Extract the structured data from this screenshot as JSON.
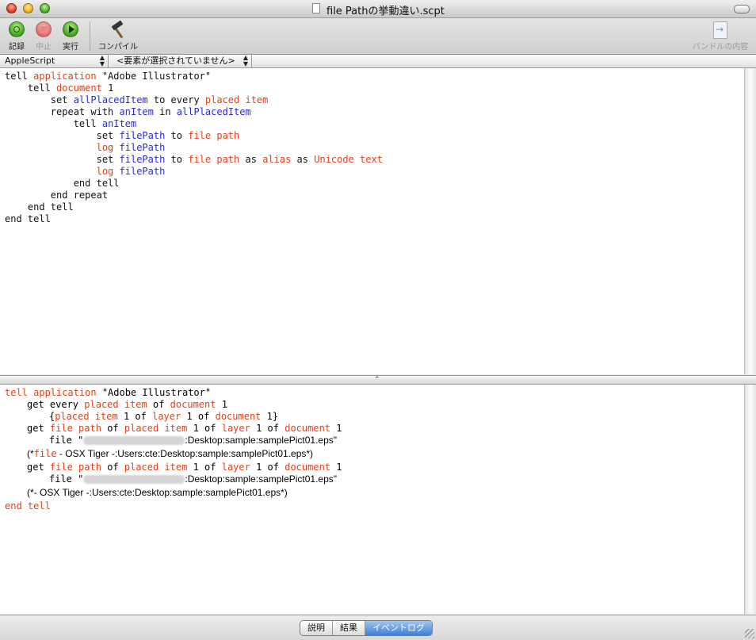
{
  "window": {
    "title": "file Pathの挙動違い.scpt"
  },
  "toolbar": {
    "record_label": "記録",
    "stop_label": "中止",
    "run_label": "実行",
    "compile_label": "コンパイル",
    "bundle_label": "バンドルの内容"
  },
  "navbar": {
    "language": "AppleScript",
    "element": "<要素が選択されていません>"
  },
  "script": {
    "l1_tell": "tell",
    "l1_app": "application",
    "l1_name": "\"Adobe Illustrator\"",
    "l2_tell": "tell",
    "l2_doc": "document",
    "l2_num": "1",
    "l3_set": "set",
    "l3_var": "allPlacedItem",
    "l3_to": "to every",
    "l3_cls": "placed item",
    "l4_repeat": "repeat with",
    "l4_var": "anItem",
    "l4_in": "in",
    "l4_var2": "allPlacedItem",
    "l5_tell": "tell",
    "l5_var": "anItem",
    "l6_set": "set",
    "l6_var": "filePath",
    "l6_to": "to",
    "l6_prop": "file path",
    "l7_log": "log",
    "l7_var": "filePath",
    "l8_set": "set",
    "l8_var": "filePath",
    "l8_to": "to",
    "l8_prop": "file path",
    "l8_as": "as",
    "l8_alias": "alias",
    "l8_as2": "as",
    "l8_uni": "Unicode text",
    "l9_log": "log",
    "l9_var": "filePath",
    "l10": "end tell",
    "l11": "end repeat",
    "l12": "end tell",
    "l13": "end tell"
  },
  "event_log": {
    "e1_tell": "tell application",
    "e1_name": "\"Adobe Illustrator\"",
    "e2_get": "get every",
    "e2_cls": "placed item",
    "e2_of": "of",
    "e2_doc": "document",
    "e2_num": "1",
    "e3_open": "{",
    "e3_cls": "placed item",
    "e3_rest1": "1 of",
    "e3_layer": "layer",
    "e3_rest2": "1 of",
    "e3_doc": "document",
    "e3_close": "1}",
    "e4_get": "get",
    "e4_prop": "file path",
    "e4_of": "of",
    "e4_cls": "placed item",
    "e4_rest1": "1 of",
    "e4_layer": "layer",
    "e4_rest2": "1 of",
    "e4_doc": "document",
    "e4_num": "1",
    "e5_file": "file \"",
    "e5_path": ":Desktop:sample:samplePict01.eps\"",
    "e6_open": "(*",
    "e6_file": "file",
    "e6_rest": " - OSX Tiger -:Users:cte:Desktop:sample:samplePict01.eps*)",
    "e7_get": "get",
    "e7_prop": "file path",
    "e7_of": "of",
    "e7_cls": "placed item",
    "e7_rest1": "1 of",
    "e7_layer": "layer",
    "e7_rest2": "1 of",
    "e7_doc": "document",
    "e7_num": "1",
    "e8_file": "file \"",
    "e8_path": ":Desktop:sample:samplePict01.eps\"",
    "e9": "(*- OSX Tiger -:Users:cte:Desktop:sample:samplePict01.eps*)",
    "e10": "end tell"
  },
  "tabs": {
    "description": "説明",
    "result": "結果",
    "event_log": "イベントログ",
    "active": "event_log"
  },
  "colors": {
    "application_term": "#e2401a",
    "variable": "#2a2ad8",
    "selected_tab": "#3f7fd6"
  }
}
